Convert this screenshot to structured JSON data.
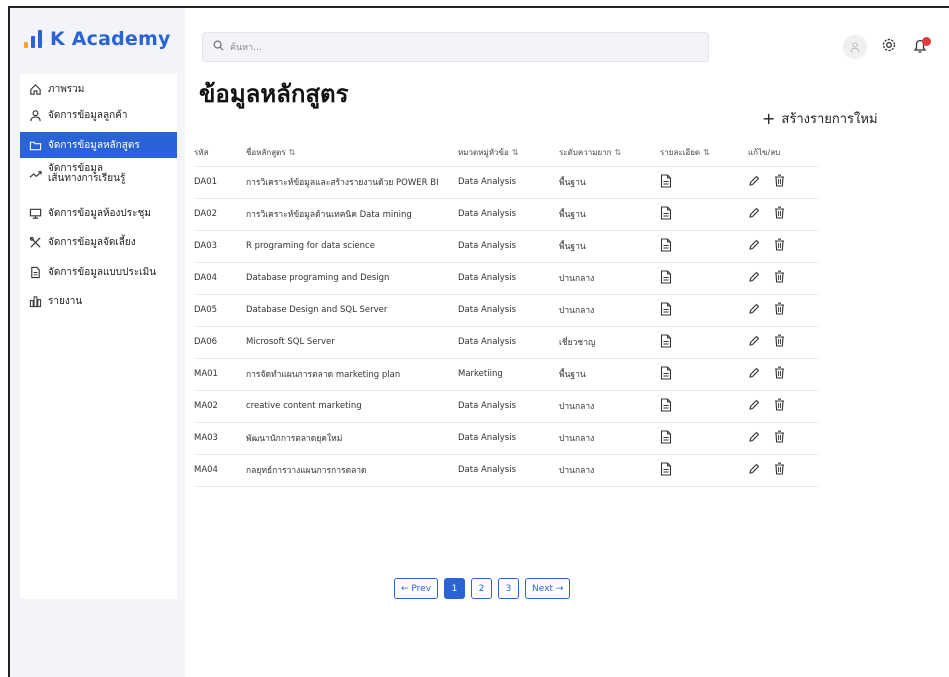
{
  "app": {
    "brand": "K Academy"
  },
  "search": {
    "placeholder": "ค้นหา..."
  },
  "sidebar": {
    "items": [
      {
        "label": "ภาพรวม",
        "icon": "home-icon"
      },
      {
        "label": "จัดการข้อมูลลูกค้า",
        "icon": "user-icon"
      },
      {
        "label": "จัดการข้อมูลหลักสูตร",
        "icon": "folder-icon",
        "active": true
      },
      {
        "label_line1": "จัดการข้อมูล",
        "label_line2": "เส้นทางการเรียนรู้",
        "icon": "trend-icon"
      },
      {
        "label": "จัดการข้อมูลห้องประชุม",
        "icon": "monitor-icon"
      },
      {
        "label": "จัดการข้อมูลจัดเลี้ยง",
        "icon": "utensils-icon"
      },
      {
        "label": "จัดการข้อมูลแบบประเมิน",
        "icon": "document-icon"
      },
      {
        "label": "รายงาน",
        "icon": "chart-icon"
      }
    ]
  },
  "main": {
    "title": "ข้อมูลหลักสูตร",
    "create_label": "สร้างรายการใหม่"
  },
  "table": {
    "headers": [
      "รหัส",
      "ชื่อหลักสูตร",
      "หมวดหมู่หัวข้อ",
      "ระดับความยาก",
      "รายละเอียด",
      "แก้ไข/ลบ"
    ],
    "rows": [
      {
        "code": "DA01",
        "name": "การวิเคราะห์ข้อมูลและสร้างรายงานด้วย POWER BI",
        "category": "Data Analysis",
        "level": "พื้นฐาน"
      },
      {
        "code": "DA02",
        "name": "การวิเคราะห์ข้อมูลด้านเทคนิค Data mining",
        "category": "Data Analysis",
        "level": "พื้นฐาน"
      },
      {
        "code": "DA03",
        "name": "R programing for data science",
        "category": "Data Analysis",
        "level": "พื้นฐาน"
      },
      {
        "code": "DA04",
        "name": "Database programing and Design",
        "category": "Data Analysis",
        "level": "ปานกลาง"
      },
      {
        "code": "DA05",
        "name": "Database Design and SQL Server",
        "category": "Data Analysis",
        "level": "ปานกลาง"
      },
      {
        "code": "DA06",
        "name": "Microsoft SQL Server",
        "category": "Data Analysis",
        "level": "เชี่ยวชาญ"
      },
      {
        "code": "MA01",
        "name": "การจัดทำแผนการตลาด marketing plan",
        "category": "Marketiing",
        "level": "พื้นฐาน"
      },
      {
        "code": "MA02",
        "name": "creative content marketing",
        "category": "Data Analysis",
        "level": "ปานกลาง"
      },
      {
        "code": "MA03",
        "name": "พัฒนานักการตลาดยุคใหม่",
        "category": "Data Analysis",
        "level": "ปานกลาง"
      },
      {
        "code": "MA04",
        "name": "กลยุทธ์การวางแผนการการตลาด",
        "category": "Data Analysis",
        "level": "ปานกลาง"
      }
    ]
  },
  "pagination": {
    "prev": "← Prev",
    "pages": [
      "1",
      "2",
      "3"
    ],
    "current": "1",
    "next": "Next →"
  },
  "colors": {
    "accent": "#2a63d6",
    "brand_bar": "#f2a23a",
    "badge": "#e23b3b"
  }
}
